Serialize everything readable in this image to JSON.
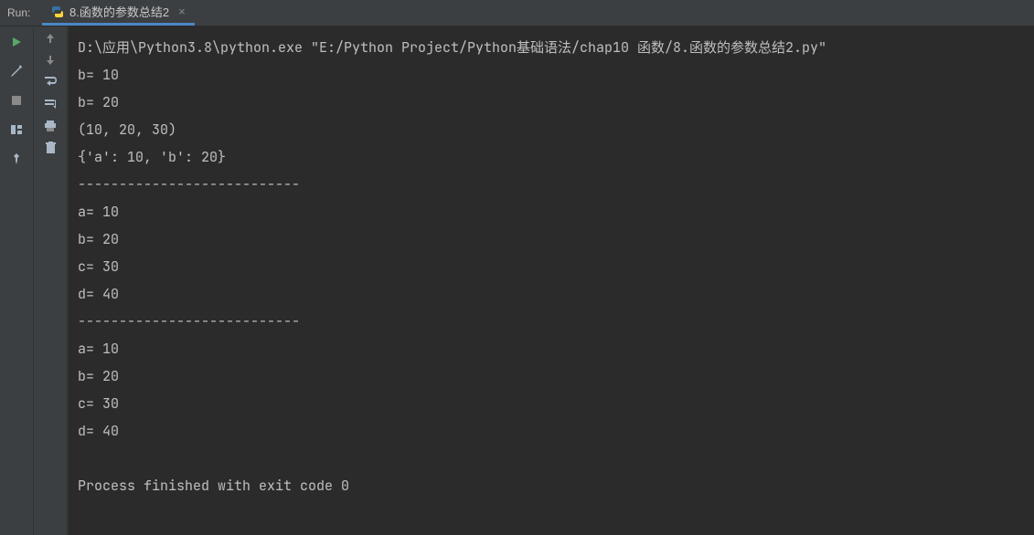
{
  "header": {
    "run_label": "Run:",
    "tab_title": "8.函数的参数总结2"
  },
  "console": {
    "command": "D:\\应用\\Python3.8\\python.exe \"E:/Python Project/Python基础语法/chap10 函数/8.函数的参数总结2.py\"",
    "lines": [
      "b= 10",
      "b= 20",
      "(10, 20, 30)",
      "{'a': 10, 'b': 20}",
      "---------------------------",
      "a= 10",
      "b= 20",
      "c= 30",
      "d= 40",
      "---------------------------",
      "a= 10",
      "b= 20",
      "c= 30",
      "d= 40",
      "",
      "Process finished with exit code 0"
    ]
  }
}
